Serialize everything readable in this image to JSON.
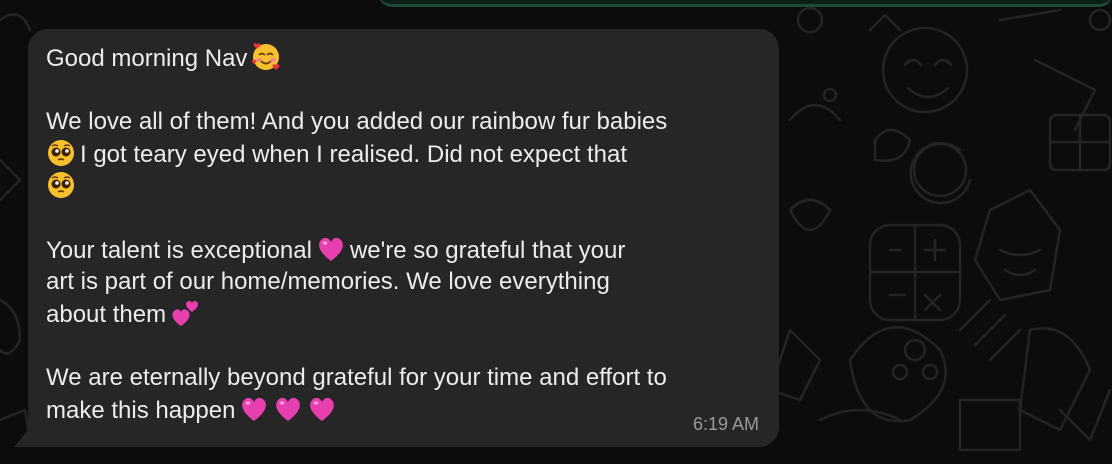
{
  "message": {
    "greeting": "Good morning Nav",
    "greeting_emoji": "smiling-face-with-hearts",
    "p2_line1": "We love all of them! And you added our rainbow fur babies",
    "p2_line2": "I got teary eyed when I realised. Did not expect that",
    "p2_emoji": "pleading-face",
    "p3_line1_a": "Your talent is exceptional",
    "p3_line1_b": "we're so grateful that your",
    "p3_line2": "art is part of our home/memories. We love everything",
    "p3_line3": "about them",
    "p3_emoji_heart": "pink-heart",
    "p3_emoji_two_hearts": "two-hearts",
    "p4_line1": "We are eternally beyond grateful for your time and effort to",
    "p4_line2": "make this happen",
    "timestamp": "6:19 AM"
  },
  "colors": {
    "background": "#0c0c0c",
    "bubble": "#262626",
    "text": "#ececec",
    "timestamp": "#9a9a9a",
    "pink_heart": "#e83fb0"
  }
}
